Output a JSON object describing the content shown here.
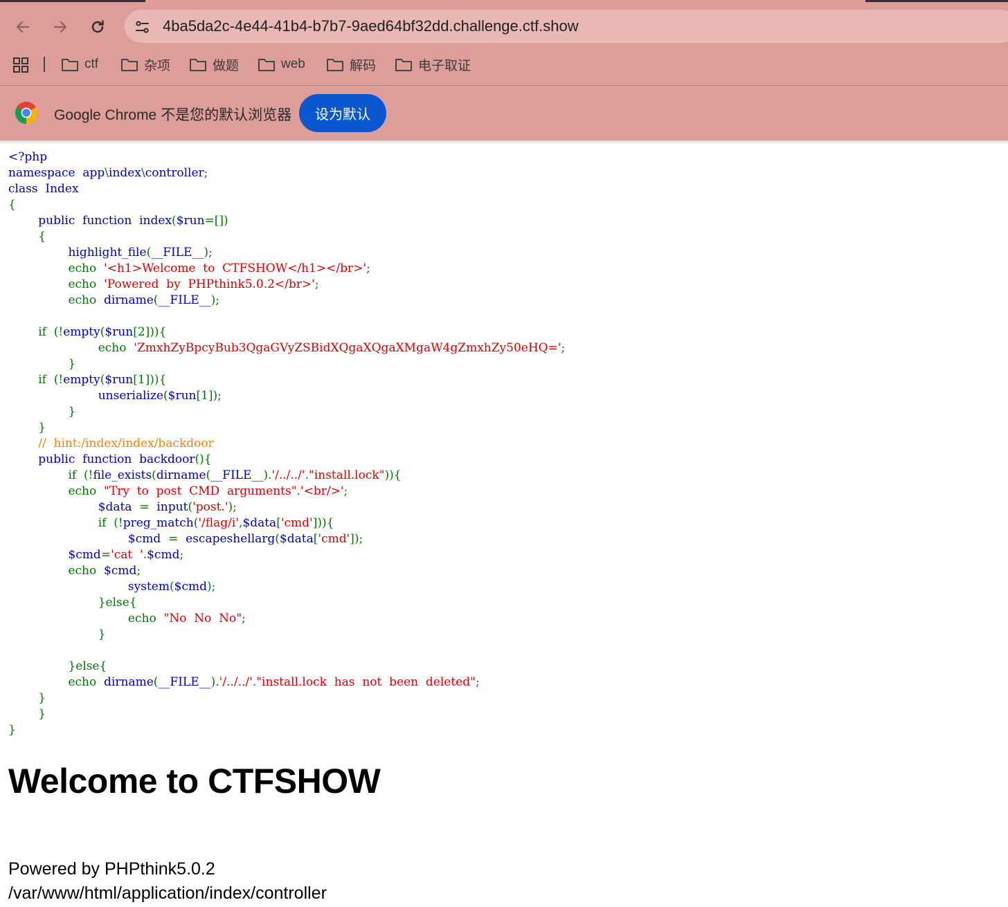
{
  "browser": {
    "url": "4ba5da2c-4e44-41b4-b7b7-9aed64bf32dd.challenge.ctf.show",
    "icons": [
      "back-arrow-icon",
      "forward-arrow-icon",
      "reload-icon",
      "site-info-icon",
      "apps-grid-icon",
      "folder-icon",
      "chrome-logo-icon"
    ],
    "bookmarks": [
      "ctf",
      "杂项",
      "做题",
      "web",
      "解码",
      "电子取证"
    ],
    "infobar_text": "Google Chrome 不是您的默认浏览器",
    "infobar_button": "设为默认",
    "colors": {
      "toolbar": "#dd9e99",
      "omnibox": "#e8b8b4",
      "button": "#0b57d0"
    }
  },
  "source": {
    "lines": [
      [
        [
          "df",
          "<?php"
        ]
      ],
      [
        [
          "df",
          "namespace  app"
        ],
        [
          "kw",
          "\\"
        ],
        [
          "df",
          "index"
        ],
        [
          "kw",
          "\\"
        ],
        [
          "df",
          "controller"
        ],
        [
          "kw",
          ";"
        ]
      ],
      [
        [
          "df",
          "class  Index"
        ]
      ],
      [
        [
          "kw",
          "{"
        ]
      ],
      [
        [
          "kw",
          "        "
        ],
        [
          "df",
          "public  function  index"
        ],
        [
          "kw",
          "("
        ],
        [
          "df",
          "$run"
        ],
        [
          "kw",
          "=[])"
        ]
      ],
      [
        [
          "kw",
          "        {"
        ]
      ],
      [
        [
          "kw",
          "                "
        ],
        [
          "df",
          "highlight_file"
        ],
        [
          "kw",
          "("
        ],
        [
          "df",
          "__FILE__"
        ],
        [
          "kw",
          ");"
        ]
      ],
      [
        [
          "kw",
          "                echo  "
        ],
        [
          "st",
          "'<h1>Welcome  to  CTFSHOW</h1></br>'"
        ],
        [
          "kw",
          ";"
        ]
      ],
      [
        [
          "kw",
          "                echo  "
        ],
        [
          "st",
          "'Powered  by  PHPthink5.0.2</br>'"
        ],
        [
          "kw",
          ";"
        ]
      ],
      [
        [
          "kw",
          "                echo  "
        ],
        [
          "df",
          "dirname"
        ],
        [
          "kw",
          "("
        ],
        [
          "df",
          "__FILE__"
        ],
        [
          "kw",
          ");"
        ]
      ],
      [],
      [
        [
          "kw",
          "        if  (!"
        ],
        [
          "df",
          "empty"
        ],
        [
          "kw",
          "("
        ],
        [
          "df",
          "$run"
        ],
        [
          "kw",
          "[2])){"
        ]
      ],
      [
        [
          "kw",
          "                        echo  "
        ],
        [
          "st",
          "'ZmxhZyBpcyBub3QgaGVyZSBidXQgaXQgaXMgaW4gZmxhZy50eHQ='"
        ],
        [
          "kw",
          ";"
        ]
      ],
      [
        [
          "kw",
          "                }"
        ]
      ],
      [
        [
          "kw",
          "        if  (!"
        ],
        [
          "df",
          "empty"
        ],
        [
          "kw",
          "("
        ],
        [
          "df",
          "$run"
        ],
        [
          "kw",
          "[1])){"
        ]
      ],
      [
        [
          "kw",
          "                        "
        ],
        [
          "df",
          "unserialize"
        ],
        [
          "kw",
          "("
        ],
        [
          "df",
          "$run"
        ],
        [
          "kw",
          "[1]);"
        ]
      ],
      [
        [
          "kw",
          "                }"
        ]
      ],
      [
        [
          "kw",
          "        }"
        ]
      ],
      [
        [
          "kw",
          "        "
        ],
        [
          "cm",
          "//  hint:/index/index/backdoor"
        ]
      ],
      [
        [
          "kw",
          "        "
        ],
        [
          "df",
          "public  function  backdoor"
        ],
        [
          "kw",
          "(){"
        ]
      ],
      [
        [
          "kw",
          "                if  (!"
        ],
        [
          "df",
          "file_exists"
        ],
        [
          "kw",
          "("
        ],
        [
          "df",
          "dirname"
        ],
        [
          "kw",
          "("
        ],
        [
          "df",
          "__FILE__"
        ],
        [
          "kw",
          ")."
        ],
        [
          "st",
          "'/../../'"
        ],
        [
          "kw",
          "."
        ],
        [
          "st",
          "\"install.lock\""
        ],
        [
          "kw",
          ")){"
        ]
      ],
      [
        [
          "kw",
          "                echo  "
        ],
        [
          "st",
          "\"Try  to  post  CMD  arguments\""
        ],
        [
          "kw",
          "."
        ],
        [
          "st",
          "'<br/>'"
        ],
        [
          "kw",
          ";"
        ]
      ],
      [
        [
          "kw",
          "                        "
        ],
        [
          "df",
          "$data  "
        ],
        [
          "kw",
          "=  "
        ],
        [
          "df",
          "input"
        ],
        [
          "kw",
          "("
        ],
        [
          "st",
          "'post.'"
        ],
        [
          "kw",
          ");"
        ]
      ],
      [
        [
          "kw",
          "                        if  (!"
        ],
        [
          "df",
          "preg_match"
        ],
        [
          "kw",
          "("
        ],
        [
          "st",
          "'/flag/i'"
        ],
        [
          "kw",
          ","
        ],
        [
          "df",
          "$data"
        ],
        [
          "kw",
          "["
        ],
        [
          "st",
          "'cmd'"
        ],
        [
          "kw",
          "])){"
        ]
      ],
      [
        [
          "kw",
          "                                "
        ],
        [
          "df",
          "$cmd  "
        ],
        [
          "kw",
          "=  "
        ],
        [
          "df",
          "escapeshellarg"
        ],
        [
          "kw",
          "("
        ],
        [
          "df",
          "$data"
        ],
        [
          "kw",
          "["
        ],
        [
          "st",
          "'cmd'"
        ],
        [
          "kw",
          "]);"
        ]
      ],
      [
        [
          "kw",
          "                "
        ],
        [
          "df",
          "$cmd"
        ],
        [
          "kw",
          "="
        ],
        [
          "st",
          "'cat  '"
        ],
        [
          "kw",
          "."
        ],
        [
          "df",
          "$cmd"
        ],
        [
          "kw",
          ";"
        ]
      ],
      [
        [
          "kw",
          "                echo  "
        ],
        [
          "df",
          "$cmd"
        ],
        [
          "kw",
          ";"
        ]
      ],
      [
        [
          "kw",
          "                                "
        ],
        [
          "df",
          "system"
        ],
        [
          "kw",
          "("
        ],
        [
          "df",
          "$cmd"
        ],
        [
          "kw",
          ");"
        ]
      ],
      [
        [
          "kw",
          "                        }else{"
        ]
      ],
      [
        [
          "kw",
          "                                echo  "
        ],
        [
          "st",
          "\"No  No  No\""
        ],
        [
          "kw",
          ";"
        ]
      ],
      [
        [
          "kw",
          "                        }"
        ]
      ],
      [],
      [
        [
          "kw",
          "                }else{"
        ]
      ],
      [
        [
          "kw",
          "                echo  "
        ],
        [
          "df",
          "dirname"
        ],
        [
          "kw",
          "("
        ],
        [
          "df",
          "__FILE__"
        ],
        [
          "kw",
          ")."
        ],
        [
          "st",
          "'/../../'"
        ],
        [
          "kw",
          "."
        ],
        [
          "st",
          "\"install.lock  has  not  been  deleted\""
        ],
        [
          "kw",
          ";"
        ]
      ],
      [
        [
          "kw",
          "        }"
        ]
      ],
      [
        [
          "kw",
          "        }"
        ]
      ],
      [
        [
          "kw",
          "}"
        ]
      ]
    ]
  },
  "page": {
    "heading": "Welcome to CTFSHOW",
    "powered": "Powered by PHPthink5.0.2",
    "path": "/var/www/html/application/index/controller"
  }
}
